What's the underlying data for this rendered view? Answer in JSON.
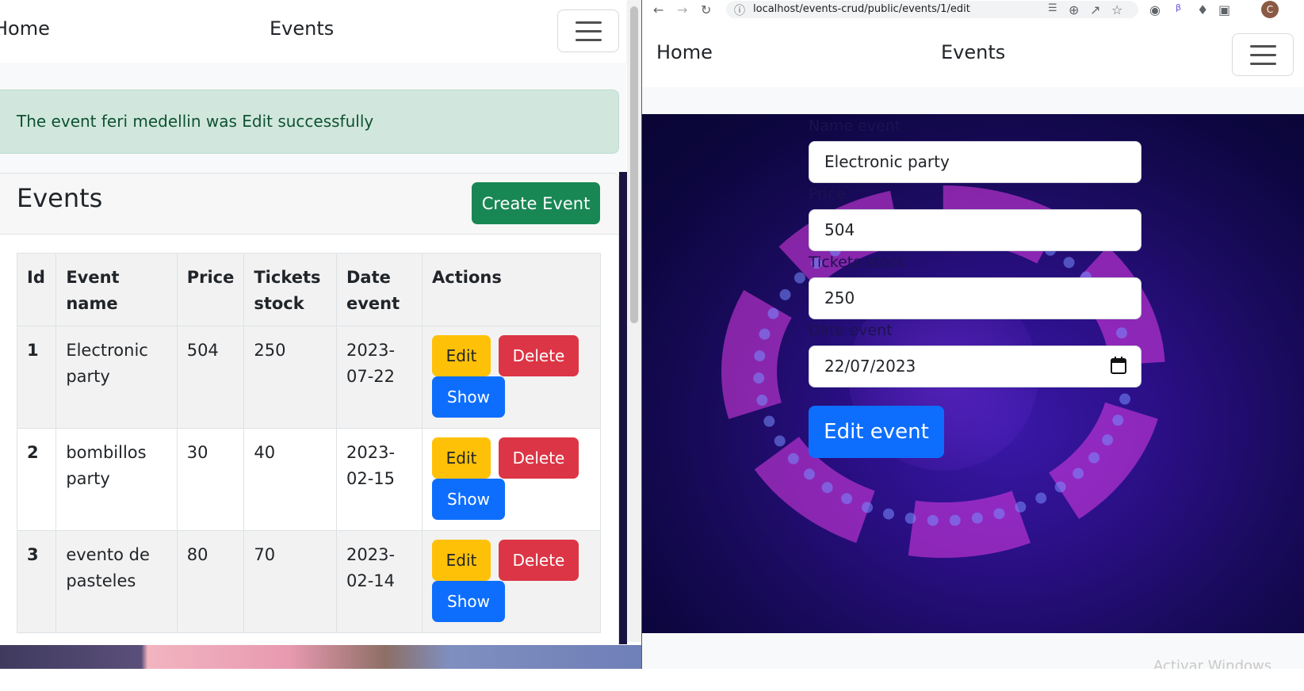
{
  "left": {
    "nav": {
      "home": "Home",
      "title": "Events"
    },
    "alert": "The event feri medellin was Edit successfully",
    "card": {
      "title": "Events",
      "create_button": "Create Event"
    },
    "table": {
      "headers": {
        "id": "Id",
        "name": "Event name",
        "price": "Price",
        "tickets": "Tickets stock",
        "date": "Date event",
        "actions": "Actions"
      },
      "rows": [
        {
          "id": "1",
          "name": "Electronic party",
          "price": "504",
          "tickets": "250",
          "date": "2023-07-22"
        },
        {
          "id": "2",
          "name": "bombillos party",
          "price": "30",
          "tickets": "40",
          "date": "2023-02-15"
        },
        {
          "id": "3",
          "name": "evento de pasteles",
          "price": "80",
          "tickets": "70",
          "date": "2023-02-14"
        }
      ],
      "actions": {
        "edit": "Edit",
        "delete": "Delete",
        "show": "Show"
      }
    }
  },
  "right": {
    "url": "localhost/events-crud/public/events/1/edit",
    "avatar": "C",
    "nav": {
      "home": "Home",
      "title": "Events"
    },
    "form": {
      "name_label": "Name event",
      "name_value": "Electronic party",
      "price_label": "Price",
      "price_value": "504",
      "tickets_label": "Tickets stock",
      "tickets_value": "250",
      "date_label": "Date event",
      "date_value": "22/07/2023",
      "submit": "Edit event"
    },
    "watermark": "Activar Windows"
  },
  "colors": {
    "success": "#198754",
    "primary": "#0d6efd",
    "warning": "#ffc107",
    "danger": "#dc3545",
    "alert_bg": "#d1e7dd"
  }
}
